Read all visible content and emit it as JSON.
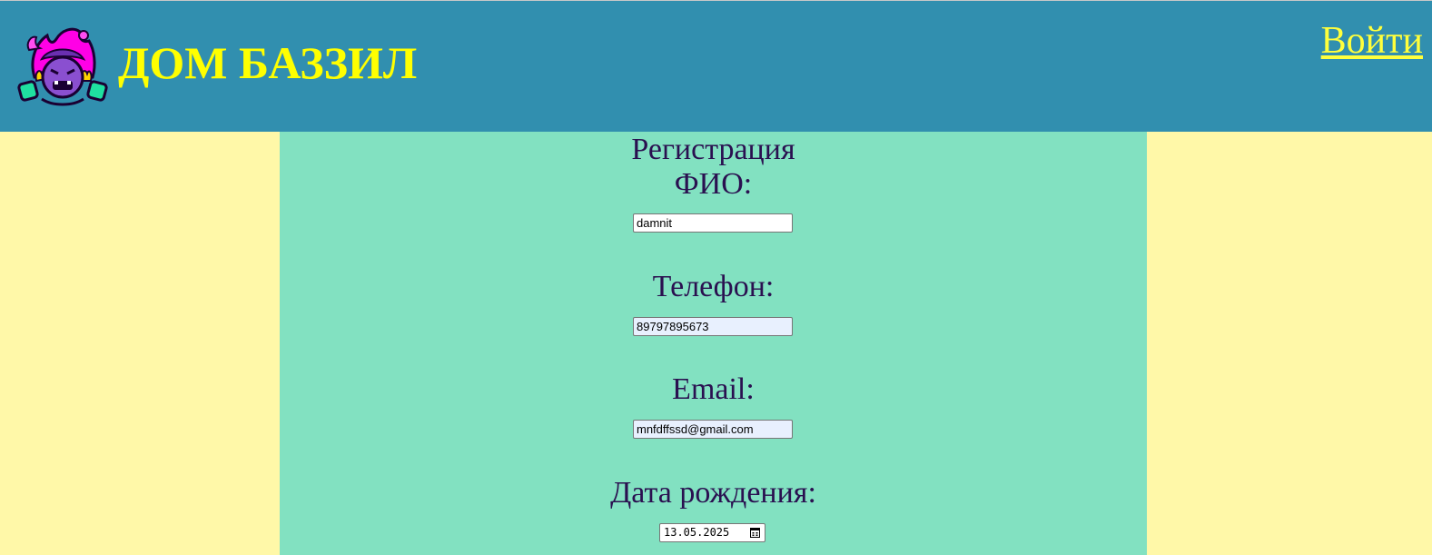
{
  "header": {
    "site_title": "ДОМ БАЗЗИЛ",
    "login_link": "Войти",
    "logo_icon": "buzz-lightyear-brawler-logo",
    "background_color": "#318faf",
    "title_color": "#ffff00"
  },
  "form": {
    "title": "Регистрация",
    "fields": [
      {
        "label": "ФИО:",
        "value": "damnit"
      },
      {
        "label": "Телефон:",
        "value": "89797895673"
      },
      {
        "label": "Email:",
        "value": "mnfdffssd@gmail.com"
      },
      {
        "label": "Дата рождения:",
        "value": "13.05.2025",
        "icon": "calendar-icon"
      }
    ]
  },
  "colors": {
    "page_background": "#fff8a8",
    "form_background": "#82e1c1",
    "label_color": "#2a1050"
  }
}
